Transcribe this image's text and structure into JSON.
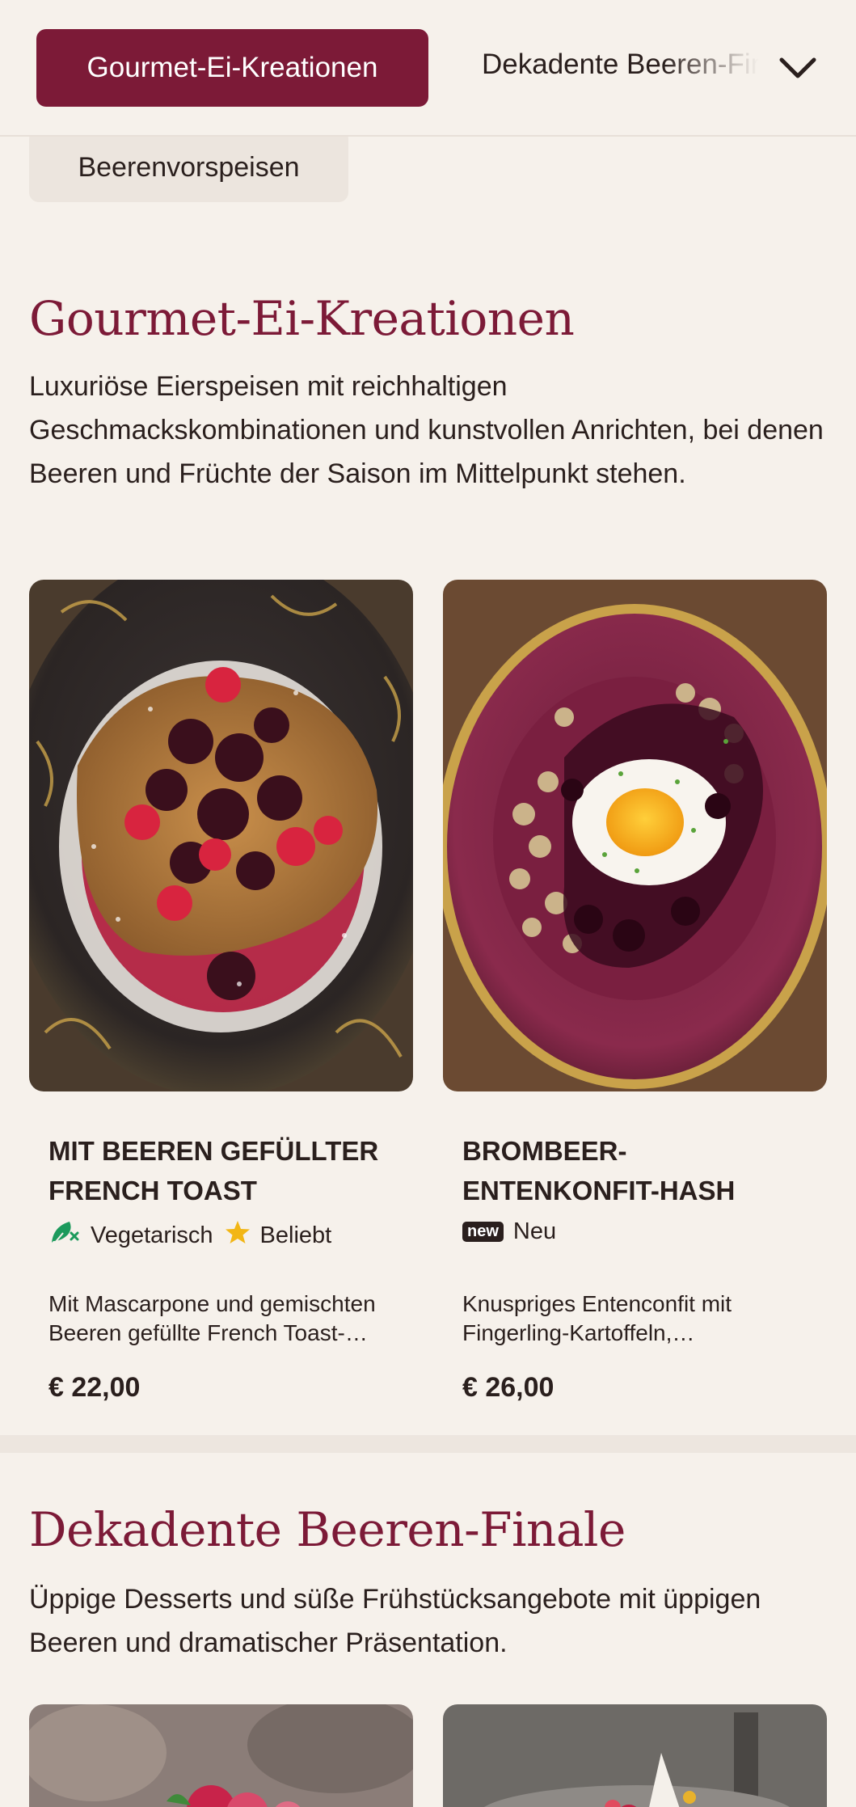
{
  "category_nav": {
    "active_label": "Gourmet-Ei-Kreationen",
    "next_label": "Dekadente Beeren-Finale",
    "previous_label": "Beerenvorspeisen",
    "expand_icon": "chevron-down-icon"
  },
  "sections": [
    {
      "title": "Gourmet-Ei-Kreationen",
      "description": "Luxuriöse Eierspeisen mit reichhaltigen Geschmackskombinationen und kunstvollen Anrichten, bei denen Beeren und Früchte der Saison im Mittelpunkt stehen.",
      "items": [
        {
          "name": "Mit Beeren gefüllter French Toast",
          "tags": [
            {
              "icon": "vegetarian-leaf-icon",
              "label": "Vegetarisch"
            },
            {
              "icon": "star-icon",
              "label": "Beliebt"
            }
          ],
          "description": "Mit Mascarpone und gemischten Beeren gefüllte French Toast-Scheiben",
          "price": "€ 22,00"
        },
        {
          "name": "Brombeer-Entenkonfit-Hash",
          "tags": [
            {
              "icon": "new-badge-icon",
              "badge": "new",
              "label": "Neu"
            }
          ],
          "description": "Knuspriges Entenconfit mit Fingerling-Kartoffeln, Brombeersauce und Spiegelei",
          "price": "€ 26,00"
        }
      ]
    },
    {
      "title": "Dekadente Beeren-Finale",
      "description": "Üppige Desserts und süße Frühstücksangebote mit üppigen Beeren und dramatischer Präsentation."
    }
  ],
  "colors": {
    "brand": "#7c1a37",
    "background": "#f6f1eb",
    "text": "#2a1f1d",
    "vegetarian": "#1c9a5c",
    "star": "#f2b615"
  }
}
